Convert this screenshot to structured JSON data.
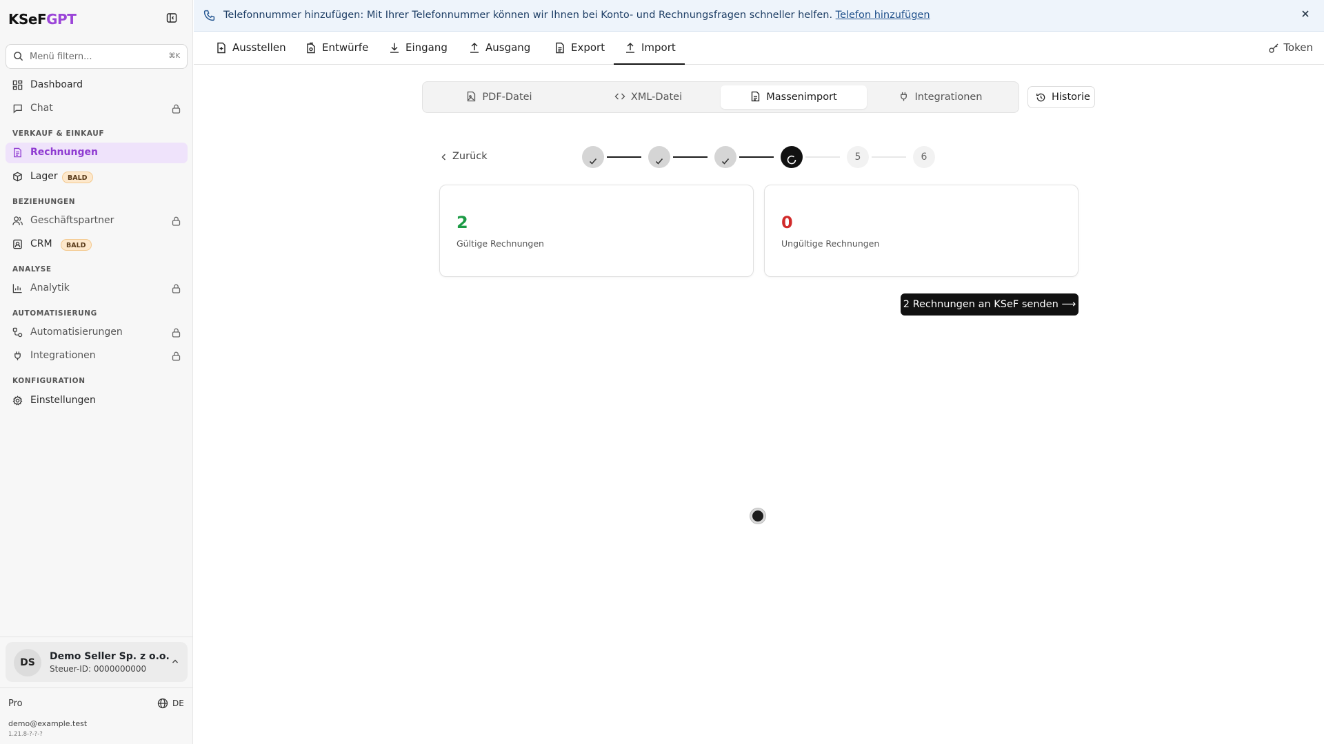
{
  "brand": {
    "part1": "KSeF",
    "part2": "GPT"
  },
  "search": {
    "placeholder": "Menü filtern...",
    "shortcut": "⌘K"
  },
  "sidebar": {
    "items": [
      {
        "label": "Dashboard"
      },
      {
        "label": "Chat"
      },
      {
        "label": "Rechnungen"
      },
      {
        "label": "Lager",
        "badge": "BALD"
      },
      {
        "label": "Geschäftspartner"
      },
      {
        "label": "CRM",
        "badge": "BALD"
      },
      {
        "label": "Analytik"
      },
      {
        "label": "Automatisierungen"
      },
      {
        "label": "Integrationen"
      },
      {
        "label": "Einstellungen"
      }
    ],
    "sections": {
      "sales": "VERKAUF & EINKAUF",
      "relations": "BEZIEHUNGEN",
      "analysis": "ANALYSE",
      "automation": "AUTOMATISIERUNG",
      "config": "KONFIGURATION"
    }
  },
  "account": {
    "initials": "DS",
    "name": "Demo Seller Sp. z o.o.",
    "tax_id": "Steuer-ID: 0000000000",
    "plan": "Pro",
    "language": "DE",
    "email": "demo@example.test",
    "version": "1.21.8-?-?-?"
  },
  "banner": {
    "text": "Telefonnummer hinzufügen: Mit Ihrer Telefonnummer können wir Ihnen bei Konto- und Rechnungsfragen schneller helfen.",
    "link": "Telefon hinzufügen"
  },
  "tabs": [
    {
      "label": "Ausstellen"
    },
    {
      "label": "Entwürfe"
    },
    {
      "label": "Eingang"
    },
    {
      "label": "Ausgang"
    },
    {
      "label": "Export"
    },
    {
      "label": "Import"
    }
  ],
  "token_label": "Token",
  "import_modes": [
    {
      "label": "PDF-Datei"
    },
    {
      "label": "XML-Datei"
    },
    {
      "label": "Massenimport"
    },
    {
      "label": "Integrationen"
    }
  ],
  "history_label": "Historie",
  "back_label": "Zurück",
  "stepper": {
    "step5": "5",
    "step6": "6",
    "completed_steps": 3,
    "current_step": 4,
    "total_steps": 6
  },
  "results": {
    "valid": {
      "count": "2",
      "label": "Gültige Rechnungen"
    },
    "invalid": {
      "count": "0",
      "label": "Ungültige Rechnungen"
    }
  },
  "send_button": "2 Rechnungen an KSeF senden ⟶",
  "colors": {
    "accent": "#9b45d8",
    "active_bg": "#efe3fb",
    "valid": "#1c9b45",
    "invalid": "#d12a2a",
    "banner_bg": "#eef4fb"
  }
}
